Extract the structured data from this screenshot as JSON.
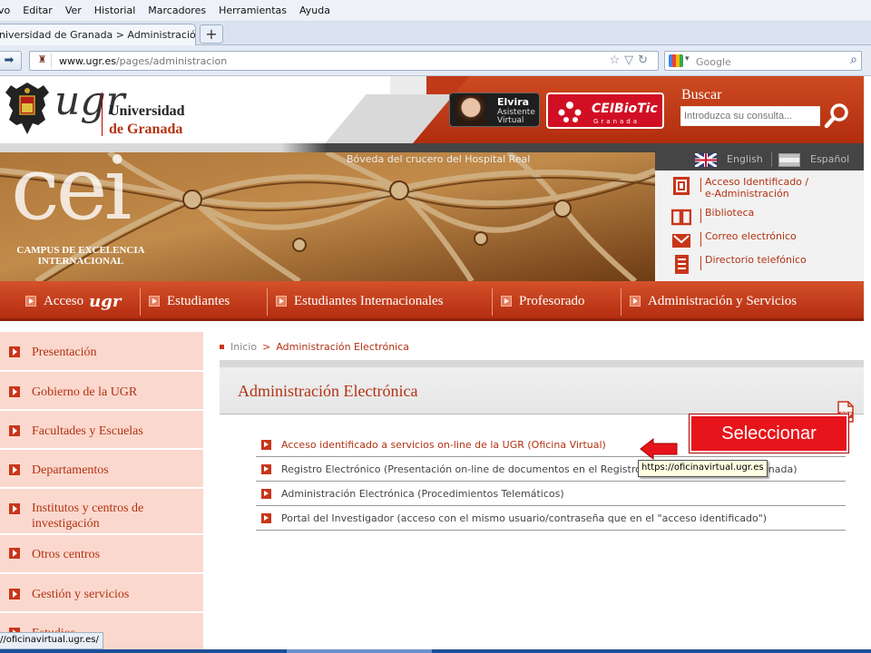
{
  "browser": {
    "menu": [
      "vo",
      "Editar",
      "Ver",
      "Historial",
      "Marcadores",
      "Herramientas",
      "Ayuda"
    ],
    "tab_title": "niversidad de Granada > Administración El...",
    "new_tab": "+",
    "url_domain": "www.ugr.es",
    "url_path": "/pages/administracion",
    "search_placeholder": "Google",
    "status_url": "//oficinavirtual.ugr.es/",
    "tooltip": "https://oficinavirtual.ugr.es"
  },
  "header": {
    "logo_ugr": "ugr",
    "logo_line1": "Universidad",
    "logo_de": "de",
    "logo_granada": "Granada",
    "elvira_name": "Elvira",
    "elvira_sub1": "Asistente",
    "elvira_sub2": "Virtual",
    "ceibiotic": "CEIBioTic",
    "ceibiotic_sub": "Granada",
    "search_label": "Buscar",
    "search_placeholder": "Introduzca su consulta..."
  },
  "banner": {
    "caption": "Bóveda del crucero del Hospital Real",
    "lang_en": "English",
    "lang_es": "Español",
    "cei": "cei",
    "cei_line1": "CAMPUS DE EXCELENCIA",
    "cei_line2": "INTERNACIONAL",
    "quick_links": [
      {
        "label": "Acceso Identificado /",
        "label2": "e-Administración",
        "icon": "id-card-icon"
      },
      {
        "label": "Biblioteca",
        "icon": "book-icon"
      },
      {
        "label": "Correo electrónico",
        "icon": "mail-icon"
      },
      {
        "label": "Directorio telefónico",
        "icon": "phone-directory-icon"
      }
    ]
  },
  "mainnav": {
    "acceso": "Acceso",
    "acceso_ugr": "ugr",
    "estudiantes": "Estudiantes",
    "internacionales": "Estudiantes Internacionales",
    "profesorado": "Profesorado",
    "administracion": "Administración y Servicios"
  },
  "sidebar": [
    {
      "label": "Presentación"
    },
    {
      "label": "Gobierno de la UGR"
    },
    {
      "label": "Facultades y Escuelas"
    },
    {
      "label": "Departamentos"
    },
    {
      "label": "Institutos y centros de",
      "label2": "investigación"
    },
    {
      "label": "Otros centros"
    },
    {
      "label": "Gestión y servicios"
    },
    {
      "label": "Estudios"
    }
  ],
  "content": {
    "breadcrumb_home": "Inicio",
    "breadcrumb_current": "Administración Electrónica",
    "title": "Administración Electrónica",
    "pdf": "PDF",
    "links": [
      "Acceso identificado a servicios on-line de la UGR (Oficina Virtual)",
      "Registro Electrónico (Presentación on-line de documentos en el Registro de la Universidad de Granada)",
      "Administración Electrónica (Procedimientos Telemáticos)",
      "Portal del Investigador (acceso con el mismo usuario/contraseña que en el \"acceso identificado\")"
    ]
  },
  "annotation": {
    "label": "Seleccionar",
    "color": "#e8141b"
  },
  "colors": {
    "brand_red": "#b23212",
    "nav_red": "#c8361a",
    "sidebar_bg": "#fbd8ce"
  }
}
